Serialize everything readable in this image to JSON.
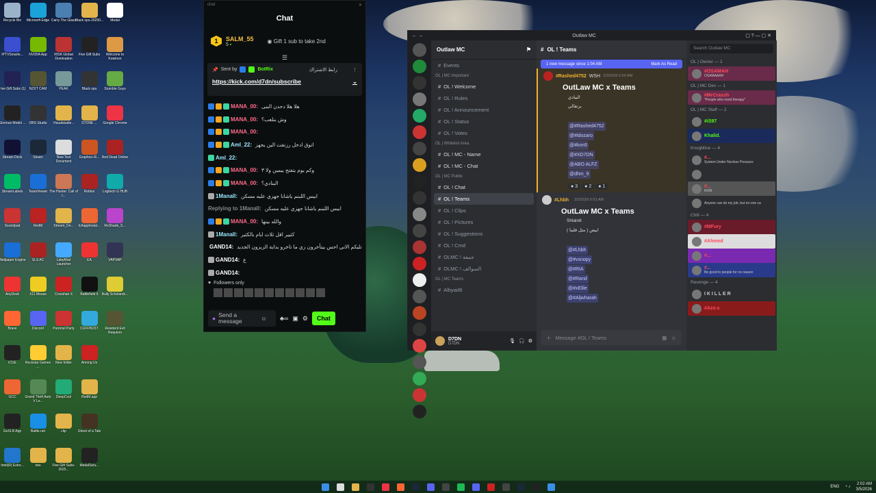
{
  "desktop_icons": [
    {
      "label": "Recycle Bin",
      "color": "#9bb3c8"
    },
    {
      "label": "Microsoft Edge",
      "color": "#1aa3d9"
    },
    {
      "label": "Carry The Glass",
      "color": "#4a7fb0"
    },
    {
      "label": "Black ops-20250...",
      "color": "#e3b44a"
    },
    {
      "label": "Medal",
      "color": "#ffffff"
    },
    {
      "label": "IPTVSmarte...",
      "color": "#3b4fd0"
    },
    {
      "label": "NVIDIA App",
      "color": "#76b900"
    },
    {
      "label": "RISK Global Domination",
      "color": "#b33"
    },
    {
      "label": "Five Gift Subs",
      "color": "#222"
    },
    {
      "label": "Welcome to Kowloon",
      "color": "#d94"
    },
    {
      "label": "Five Gift Subs (1)",
      "color": "#225"
    },
    {
      "label": "NZXT CAM",
      "color": "#553"
    },
    {
      "label": "PEAK",
      "color": "#799"
    },
    {
      "label": "Black ops",
      "color": "#333"
    },
    {
      "label": "Stumble Guys",
      "color": "#6a4"
    },
    {
      "label": "Glorious Model ...",
      "color": "#222"
    },
    {
      "label": "OBS Studio",
      "color": "#333"
    },
    {
      "label": "Visualstudio...",
      "color": "#e3b44a"
    },
    {
      "label": "STONE ...",
      "color": "#e3b44a"
    },
    {
      "label": "Google Chrome",
      "color": "#e34"
    },
    {
      "label": "Stream Deck",
      "color": "#113"
    },
    {
      "label": "Steam",
      "color": "#1b2838"
    },
    {
      "label": "New Text Document",
      "color": "#ddd"
    },
    {
      "label": "Graphics-R...",
      "color": "#c52"
    },
    {
      "label": "Red Dead Online",
      "color": "#a22"
    },
    {
      "label": "StreamLabels",
      "color": "#0b6"
    },
    {
      "label": "TeamViewer",
      "color": "#1a6fd6"
    },
    {
      "label": "The Hunter: Call of t...",
      "color": "#c75"
    },
    {
      "label": "Roblox",
      "color": "#a22"
    },
    {
      "label": "Logitech G HUB",
      "color": "#1aa"
    },
    {
      "label": "Soundpad",
      "color": "#c33"
    },
    {
      "label": "RedM",
      "color": "#b22"
    },
    {
      "label": "Stream_De...",
      "color": "#e3b44a"
    },
    {
      "label": "EAappInstal...",
      "color": "#e63"
    },
    {
      "label": "ReShade_S...",
      "color": "#b4c"
    },
    {
      "label": "Wallpaper Engine",
      "color": "#1a6fd6"
    },
    {
      "label": "SLS AC",
      "color": "#a22"
    },
    {
      "label": "LabyMod Launcher",
      "color": "#4af"
    },
    {
      "label": "EA",
      "color": "#e33"
    },
    {
      "label": "VAPVAP",
      "color": "#335"
    },
    {
      "label": "AnyDesk",
      "color": "#e33"
    },
    {
      "label": "X11 Mouse",
      "color": "#ec2"
    },
    {
      "label": "Crosshair X",
      "color": "#c22"
    },
    {
      "label": "Battlefield 6",
      "color": "#111"
    },
    {
      "label": "Bully Scholarsh...",
      "color": "#dc3"
    },
    {
      "label": "Brave",
      "color": "#f63"
    },
    {
      "label": "Discord",
      "color": "#5865f2"
    },
    {
      "label": "Pummel Party",
      "color": "#c33"
    },
    {
      "label": "CUFFBUST",
      "color": "#3ad"
    },
    {
      "label": "Resident Evil Requiem",
      "color": "#553"
    },
    {
      "label": "iCUE",
      "color": "#222"
    },
    {
      "label": "Rockstar Games ...",
      "color": "#fc3"
    },
    {
      "label": "New folder",
      "color": "#e3b44a"
    },
    {
      "label": "Among Us",
      "color": "#c22"
    },
    {
      "label": "",
      "color": "transparent"
    },
    {
      "label": "GCC",
      "color": "#e63"
    },
    {
      "label": "Grand Theft Auto V Le...",
      "color": "#585"
    },
    {
      "label": "DeepCool",
      "color": "#2a7"
    },
    {
      "label": "RedM.app",
      "color": "#e3b44a"
    },
    {
      "label": "",
      "color": "transparent"
    },
    {
      "label": "GoXLR App",
      "color": "#222"
    },
    {
      "label": "Battle.net",
      "color": "#1a8fe6"
    },
    {
      "label": "clip",
      "color": "#e3b44a"
    },
    {
      "label": "Ghost of a Tale",
      "color": "#432"
    },
    {
      "label": "",
      "color": "transparent"
    },
    {
      "label": "Intel(R) Extre...",
      "color": "#27c"
    },
    {
      "label": "obs",
      "color": "#e3b44a"
    },
    {
      "label": "Five Gift Subs-2025...",
      "color": "#e3b44a"
    },
    {
      "label": "MedalSetu...",
      "color": "#222"
    },
    {
      "label": "",
      "color": "transparent"
    }
  ],
  "chat": {
    "window_label": "chat",
    "title": "Chat",
    "top_sub": {
      "rank": "1",
      "name": "SALM_55",
      "count": "5",
      "gift_text": "Gift 1 sub to take 2nd"
    },
    "pinned": {
      "sent_by": "Sent by",
      "bot": "BotRix",
      "link": "https://kick.com/d7dn/subscribe",
      "arabic": "رابط الاشتراك"
    },
    "messages": [
      {
        "name": "MANA_00:",
        "color": "#ff6b8a",
        "text": "هلا هلا دحدن البنى",
        "badges": [
          "#2b7de9",
          "#f5a623",
          "#3cd6a0"
        ]
      },
      {
        "name": "MANA_00:",
        "color": "#ff6b8a",
        "text": "وش بنلعب؟",
        "badges": [
          "#2b7de9",
          "#f5a623",
          "#3cd6a0"
        ]
      },
      {
        "name": "MANA_00:",
        "color": "#ff6b8a",
        "text": "",
        "badges": [
          "#2b7de9",
          "#f5a623",
          "#3cd6a0"
        ]
      },
      {
        "name": "Aml_22:",
        "color": "#9be8ff",
        "text": "اتوق ادخل رزنقت الين يجهز",
        "badges": [
          "#2b7de9",
          "#f5a623",
          "#3cd6a0"
        ]
      },
      {
        "name": "Aml_22:",
        "color": "#9be8ff",
        "text": "",
        "badges": [
          "#3cd6a0"
        ]
      },
      {
        "name": "MANA_00:",
        "color": "#ff6b8a",
        "text": "وكم يوم يتفتح ييمين ولا ٣",
        "badges": [
          "#2b7de9",
          "#f5a623",
          "#3cd6a0"
        ]
      },
      {
        "name": "MANA_00:",
        "color": "#ff6b8a",
        "text": "البنادي؟",
        "badges": [
          "#2b7de9",
          "#f5a623",
          "#3cd6a0"
        ]
      },
      {
        "name": "1Manall:",
        "color": "#9be8ff",
        "text": "ابيس اللبنم ياشانا جهزي عليه مسكن",
        "badges": [
          "#aaa"
        ]
      },
      {
        "name": "Replying to 1Manall:",
        "color": "#888",
        "text": "ابيس اللبنم ياشانا جهزي عليه مسكن",
        "badges": []
      },
      {
        "name": "MANA_00:",
        "color": "#ff6b8a",
        "text": "والله بينها",
        "badges": [
          "#2b7de9",
          "#f5a623",
          "#3cd6a0"
        ]
      },
      {
        "name": "1Manall:",
        "color": "#9be8ff",
        "text": "كثيير اقل ثلاث ايام بالكثير",
        "badges": [
          "#aaa"
        ]
      },
      {
        "name": "GAND14:",
        "color": "#ffffff",
        "text": "اشوف انا تسحب عليكم الاني احس بيتأخرون زي ما تاخرو بداية الزيزون الجديد",
        "badges": [
          "#aaa"
        ]
      },
      {
        "name": "GAND14:",
        "color": "#ffffff",
        "text": "ع",
        "badges": [
          "#aaa"
        ]
      },
      {
        "name": "GAND14:",
        "color": "#ffffff",
        "text": "",
        "badges": [
          "#aaa"
        ]
      }
    ],
    "followers_only": "Followers only",
    "input_placeholder": "Send a message",
    "send_label": "Chat"
  },
  "discord": {
    "window_title": "Outlaw MC",
    "server_name": "Outlaw MC",
    "channel_header": "OL ! Teams",
    "search_placeholder": "Search Outlaw MC",
    "channels": [
      {
        "label": "Events",
        "type": "item"
      },
      {
        "label": "OL | MC Important",
        "type": "cat"
      },
      {
        "label": "OL ! Welcome",
        "type": "item",
        "bright": true
      },
      {
        "label": "OL ! Rules",
        "type": "item"
      },
      {
        "label": "OL ! Announcement",
        "type": "item"
      },
      {
        "label": "OL ! Status",
        "type": "item"
      },
      {
        "label": "OL ! Votes",
        "type": "item"
      },
      {
        "label": "OL | Whitelist Area",
        "type": "cat"
      },
      {
        "label": "OL ! MC - Name",
        "type": "item",
        "bright": true
      },
      {
        "label": "OL ! MC - Chat",
        "type": "item",
        "bright": true
      },
      {
        "label": "OL | MC Public",
        "type": "cat"
      },
      {
        "label": "OL ! Chat",
        "type": "item",
        "bright": true
      },
      {
        "label": "OL ! Teams",
        "type": "item",
        "sel": true
      },
      {
        "label": "OL ! Clips",
        "type": "item"
      },
      {
        "label": "OL ! Pictures",
        "type": "item"
      },
      {
        "label": "OL ! Suggestions",
        "type": "item"
      },
      {
        "label": "OL ! Cmd",
        "type": "item"
      },
      {
        "label": "OLMC ! جمعة",
        "type": "item"
      },
      {
        "label": "OLMC ! السوالف",
        "type": "item"
      },
      {
        "label": "OL | MC Teams",
        "type": "cat"
      },
      {
        "label": "Albyad8",
        "type": "item"
      }
    ],
    "new_messages": "1 new message since 1:04 AM",
    "mark_read": "Mark As Read",
    "posts": [
      {
        "author": "#Rashed4752",
        "tag": "WSH",
        "time": "3/3/2026 5:59 AM",
        "title": "OutLaw MC x Teams",
        "lines": [
          "البيادي",
          "برتقالي"
        ],
        "mentions": [
          "@#Rashed4752",
          "@#idozaro",
          "@#knn5",
          "@#XD7DN",
          "@ABO ALFZ",
          "@dhm_9"
        ],
        "reactions": [
          "3",
          "2",
          "1"
        ]
      },
      {
        "author": "#Lhbh",
        "tag": "",
        "time": "3/3/2026 6:51 AM",
        "title": "OutLaw MC x Teams",
        "lines": [
          "Shlalo6",
          "ابيض ( مثل قلبنا )"
        ],
        "mentions": [
          "@#Lhbh",
          "@#vsnopy",
          "@#RIA",
          "@#Rand",
          "@#xElile",
          "@#Aljwharah"
        ],
        "reactions": []
      }
    ],
    "message_placeholder": "Message #OL ! Teams",
    "user": {
      "name": "D7DN",
      "status": "D7DN"
    },
    "member_groups": [
      {
        "title": "OL | Owner — 1",
        "members": [
          {
            "name": "#OSAMAH",
            "color": "#ff4b5c",
            "sub": "OSAMAAAH",
            "bg": "#6a2b4a"
          }
        ]
      },
      {
        "title": "OL | MC Dev — 1",
        "members": [
          {
            "name": "#MrCrassh",
            "color": "#ff4b5c",
            "sub": "\"People who need therapy\"",
            "bg": "#6a2b4a"
          }
        ]
      },
      {
        "title": "OL | MC Staff — 2",
        "members": [
          {
            "name": "#iS97",
            "color": "#53fc18",
            "sub": "",
            "bg": ""
          },
          {
            "name": "Khalid.",
            "color": "#53fc18",
            "sub": "",
            "bg": "#1a2a5a"
          }
        ]
      },
      {
        "title": "KnogMine — 4",
        "members": [
          {
            "name": "#...",
            "color": "#ff4b5c",
            "sub": "System Under Nuclear Pressure",
            "bg": ""
          },
          {
            "name": "",
            "color": "#ccc",
            "sub": "",
            "bg": ""
          },
          {
            "name": "#...",
            "color": "#ff4b5c",
            "sub": "NVM",
            "bg": "#555"
          },
          {
            "name": "",
            "color": "#ccc",
            "sub": "Anyone can do my job, but no-one ca",
            "bg": ""
          }
        ]
      },
      {
        "title": "Chill — 4",
        "members": [
          {
            "name": "#MFury",
            "color": "#ff4b5c",
            "sub": "",
            "bg": "#6a1b2a"
          },
          {
            "name": "#Ahmed",
            "color": "#ff4b5c",
            "sub": "",
            "bg": "#ddd"
          },
          {
            "name": "#...",
            "color": "#ff4b5c",
            "sub": "",
            "bg": "#7a2ab0"
          },
          {
            "name": "#...",
            "color": "#ff4b5c",
            "sub": "Be good to people for no reason",
            "bg": "#2a3a8a"
          }
        ]
      },
      {
        "title": "Revenge — 4",
        "members": [
          {
            "name": "I K I L L E R",
            "color": "#ccc",
            "sub": "",
            "bg": ""
          },
          {
            "name": "#Azo.s",
            "color": "#ff4b5c",
            "sub": "",
            "bg": "#8a1b1b"
          }
        ]
      }
    ]
  },
  "taskbar": {
    "lang": "ENG",
    "time": "2:02 AM",
    "date": "3/5/2026"
  }
}
